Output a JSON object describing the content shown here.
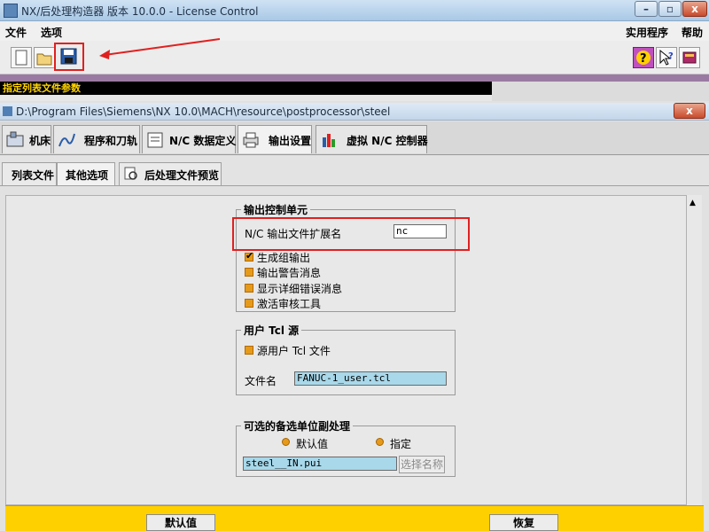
{
  "window": {
    "title": "NX/后处理构造器 版本 10.0.0 - License Control",
    "minimize": "–",
    "maximize": "▫",
    "close": "x"
  },
  "menu": {
    "left": [
      "文件",
      "选项"
    ],
    "right": [
      "实用程序",
      "帮助"
    ]
  },
  "status": {
    "text": "指定列表文件参数"
  },
  "inner_window": {
    "title": "D:\\Program Files\\Siemens\\NX 10.0\\MACH\\resource\\postprocessor\\steel",
    "close": "x"
  },
  "tabs_main": [
    {
      "label": "机床"
    },
    {
      "label": "程序和刀轨"
    },
    {
      "label": "N/C 数据定义"
    },
    {
      "label": "输出设置"
    },
    {
      "label": "虚拟 N/C 控制器"
    }
  ],
  "tabs_sub": [
    {
      "label": "列表文件"
    },
    {
      "label": "其他选项"
    },
    {
      "label": "后处理文件预览"
    }
  ],
  "output_control": {
    "title": "输出控制单元",
    "ext_label": "N/C 输出文件扩展名",
    "ext_value": "nc",
    "checks": [
      "生成组输出",
      "输出警告消息",
      "显示详细错误消息",
      "激活审核工具"
    ]
  },
  "user_tcl": {
    "title": "用户 Tcl 源",
    "check": "源用户 Tcl 文件",
    "file_label": "文件名",
    "file_value": "FANUC-1_user.tcl"
  },
  "units": {
    "title": "可选的备选单位副处理",
    "radio_default": "默认值",
    "radio_specify": "指定",
    "file_value": "steel__IN.pui",
    "select_button": "选择名称"
  },
  "bottom": {
    "default_button": "默认值",
    "restore_button": "恢复"
  },
  "colors": {
    "highlight": "#e02020",
    "status_bg": "#000000",
    "status_fg": "#ffd400",
    "bottom_bar": "#ffd000"
  }
}
